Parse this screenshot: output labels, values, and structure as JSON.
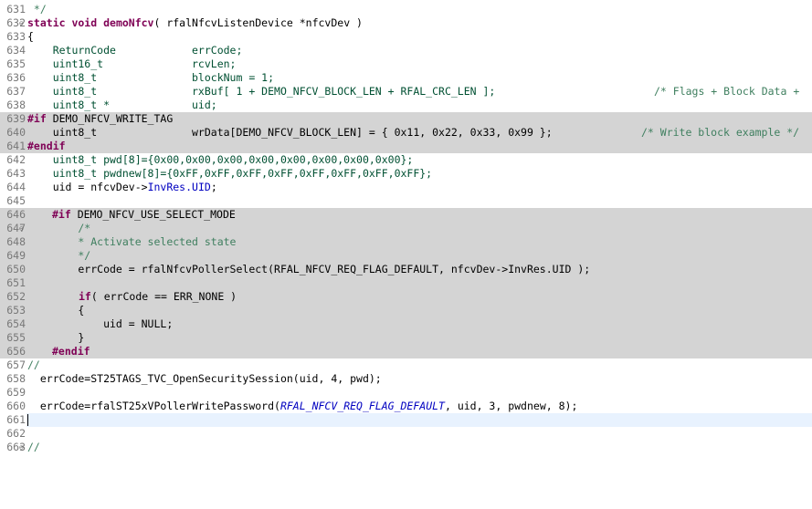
{
  "line_numbers": [
    "631",
    "632",
    "633",
    "634",
    "635",
    "636",
    "637",
    "638",
    "639",
    "640",
    "641",
    "642",
    "643",
    "644",
    "645",
    "646",
    "647",
    "648",
    "649",
    "650",
    "651",
    "652",
    "653",
    "654",
    "655",
    "656",
    "657",
    "658",
    "659",
    "660",
    "661",
    "662",
    "663"
  ],
  "code": {
    "l631": " */",
    "l632_kw": "static void ",
    "l632_fn": "demoNfcv",
    "l632_rest": "( rfalNfcvListenDevice *nfcvDev )",
    "l633": "{",
    "l634": "    ReturnCode            errCode;",
    "l635": "    uint16_t              rcvLen;",
    "l636": "    uint8_t               blockNum = 1;",
    "l637_code": "    uint8_t               rxBuf[ 1 + DEMO_NFCV_BLOCK_LEN + RFAL_CRC_LEN ];",
    "l637_comment": "/* Flags + Block Data +",
    "l638": "    uint8_t *             uid;",
    "l639_pp": "#if",
    "l639_rest": " DEMO_NFCV_WRITE_TAG",
    "l640_code": "    uint8_t               wrData[DEMO_NFCV_BLOCK_LEN] = { 0x11, 0x22, 0x33, 0x99 };",
    "l640_comment": "/* Write block example */",
    "l641": "#endif",
    "l642": "    uint8_t pwd[8]={0x00,0x00,0x00,0x00,0x00,0x00,0x00,0x00};",
    "l643": "    uint8_t pwdnew[8]={0xFF,0xFF,0xFF,0xFF,0xFF,0xFF,0xFF,0xFF};",
    "l644_a": "    uid = nfcvDev->",
    "l644_field": "InvRes.UID",
    "l644_b": ";",
    "l645": "",
    "l646_pp": "#if",
    "l646_rest": " DEMO_NFCV_USE_SELECT_MODE",
    "l647": "        /*",
    "l648": "        * Activate selected state",
    "l649": "        */",
    "l650": "        errCode = rfalNfcvPollerSelect(RFAL_NFCV_REQ_FLAG_DEFAULT, nfcvDev->InvRes.UID );",
    "l651": "",
    "l652_kw": "if",
    "l652_rest": "( errCode == ERR_NONE )",
    "l653": "        {",
    "l654": "            uid = NULL;",
    "l655": "        }",
    "l656": "#endif",
    "l657": "//",
    "l658": "  errCode=ST25TAGS_TVC_OpenSecuritySession(uid, 4, pwd);",
    "l659": "",
    "l660_a": "  errCode=rfalST25xVPollerWritePassword(",
    "l660_it": "RFAL_NFCV_REQ_FLAG_DEFAULT",
    "l660_b": ", uid, 3, pwdnew, 8);",
    "l661": "",
    "l662": "",
    "l663": "//"
  },
  "fold_markers": {
    "l632": "⊖",
    "l647": "⊖",
    "l663": "⊖"
  }
}
